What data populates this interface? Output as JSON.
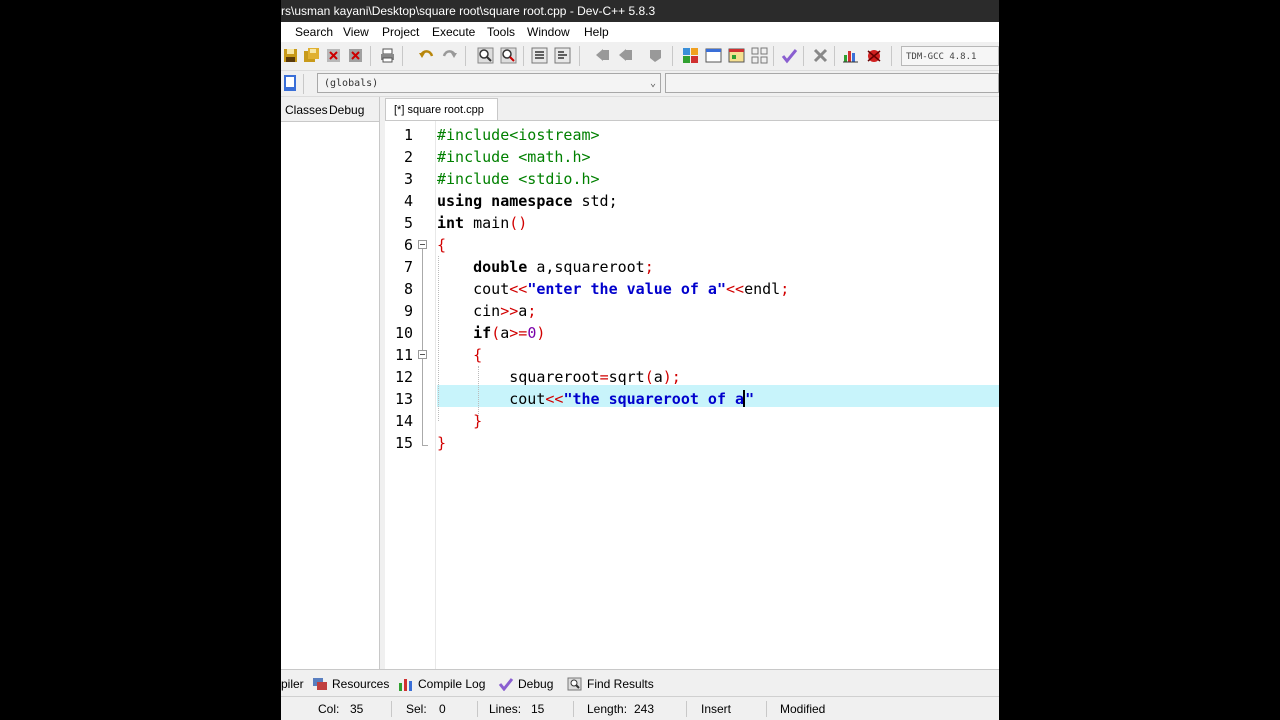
{
  "window": {
    "title": "rs\\usman kayani\\Desktop\\square root\\square root.cpp - Dev-C++ 5.8.3"
  },
  "menu": {
    "items": [
      "Search",
      "View",
      "Project",
      "Execute",
      "Tools",
      "Window",
      "Help"
    ]
  },
  "toolbar": {
    "compiler": "TDM-GCC 4.8.1"
  },
  "scope": {
    "value": "(globals)"
  },
  "left_panel": {
    "tabs": [
      "Classes",
      "Debug"
    ]
  },
  "editor": {
    "tab_label": "[*] square root.cpp",
    "lines": [
      {
        "n": "1",
        "code": "#include<iostream>"
      },
      {
        "n": "2",
        "code": "#include <math.h>"
      },
      {
        "n": "3",
        "code": "#include <stdio.h>"
      },
      {
        "n": "4",
        "code": "using namespace std;"
      },
      {
        "n": "5",
        "code": "int main()"
      },
      {
        "n": "6",
        "code": "{"
      },
      {
        "n": "7",
        "code": "    double a,squareroot;"
      },
      {
        "n": "8",
        "code": "    cout<<\"enter the value of a\"<<endl;"
      },
      {
        "n": "9",
        "code": "    cin>>a;"
      },
      {
        "n": "10",
        "code": "    if(a>=0)"
      },
      {
        "n": "11",
        "code": "    {"
      },
      {
        "n": "12",
        "code": "        squareroot=sqrt(a);"
      },
      {
        "n": "13",
        "code": "        cout<<\"the squareroot of a\""
      },
      {
        "n": "14",
        "code": "    }"
      },
      {
        "n": "15",
        "code": "}"
      }
    ],
    "current_line": "13"
  },
  "bottom_tabs": [
    "piler",
    "Resources",
    "Compile Log",
    "Debug",
    "Find Results"
  ],
  "status": {
    "col_label": "Col:",
    "col": "35",
    "sel_label": "Sel:",
    "sel": "0",
    "lines_label": "Lines:",
    "lines": "15",
    "length_label": "Length:",
    "length": "243",
    "mode": "Insert",
    "modified": "Modified"
  }
}
